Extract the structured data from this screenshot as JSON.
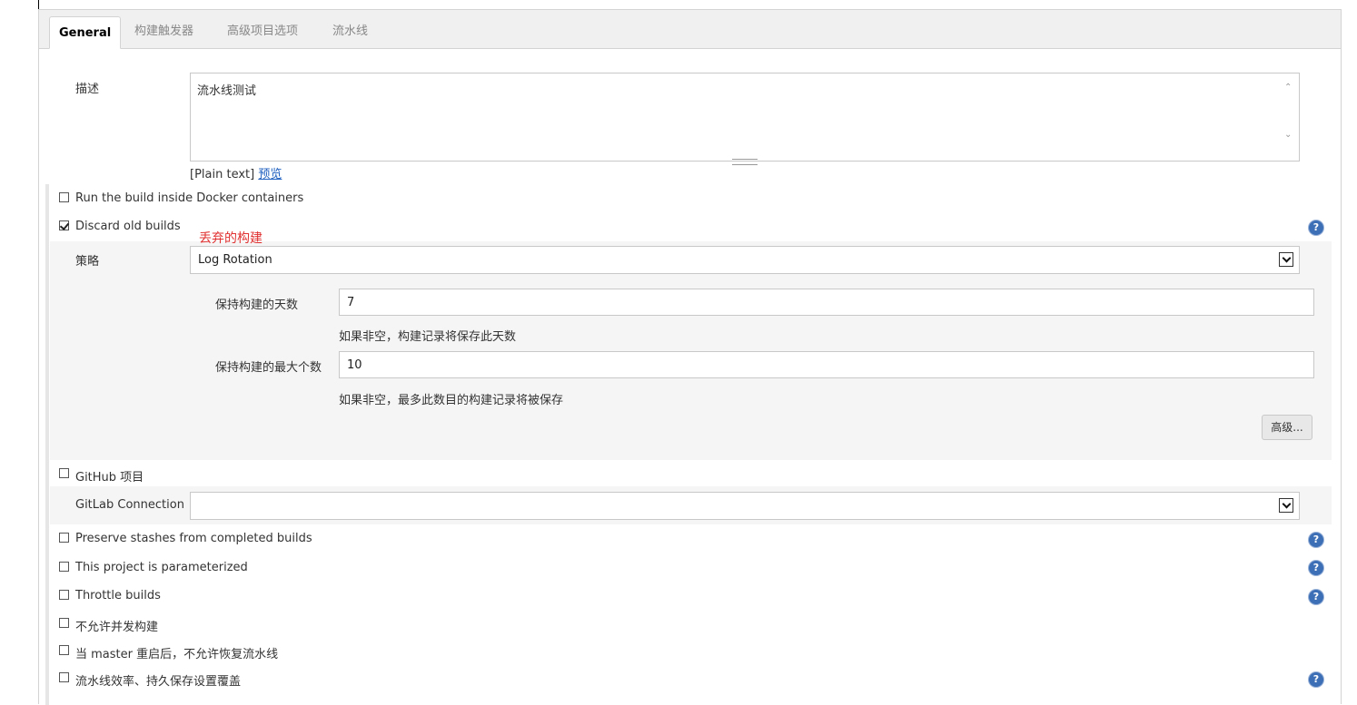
{
  "tabs": [
    "General",
    "构建触发器",
    "高级项目选项",
    "流水线"
  ],
  "description": {
    "label": "描述",
    "value": "流水线测试",
    "format_text": "[Plain text]",
    "preview_link": "预览"
  },
  "options": {
    "docker": "Run the build inside Docker containers",
    "discard": "Discard old builds",
    "github": "GitHub 项目",
    "preserve_stashes": "Preserve stashes from completed builds",
    "parameterized": "This project is parameterized",
    "throttle": "Throttle builds",
    "no_concurrent": "不允许并发构建",
    "no_resume": "当 master 重启后，不允许恢复流水线",
    "durability": "流水线效率、持久保存设置覆盖"
  },
  "annotation": "丢弃的构建",
  "strategy": {
    "label": "策略",
    "value": "Log Rotation",
    "days_label": "保持构建的天数",
    "days_value": "7",
    "days_hint": "如果非空，构建记录将保存此天数",
    "max_label": "保持构建的最大个数",
    "max_value": "10",
    "max_hint": "如果非空，最多此数目的构建记录将被保存",
    "advanced_button": "高级..."
  },
  "gitlab": {
    "label": "GitLab Connection",
    "value": ""
  },
  "help_glyph": "?",
  "colors": {
    "annotation": "#e03030",
    "help_icon": "#3d6fb6",
    "link": "#2060c0"
  }
}
